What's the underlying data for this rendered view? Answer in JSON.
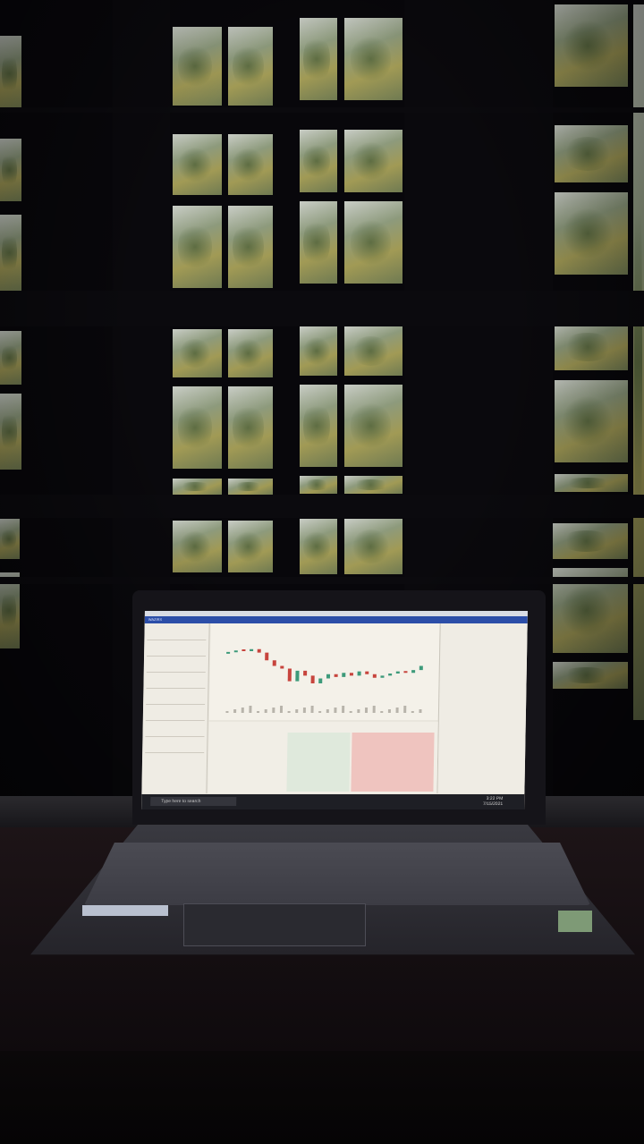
{
  "photo": {
    "subject": "laptop-in-front-of-window",
    "colors": {
      "wall": "#08070b",
      "glass_light": "#c9cdc6",
      "foliage": "#8d9a7c",
      "desk": "#1d1417",
      "laptop": "#151419",
      "screen": "#e9e6dd",
      "chart_up": "#3d9a7a",
      "chart_down": "#c7443d",
      "app_accent": "#2c4ea8"
    }
  },
  "screen": {
    "taskbar_search": "Type here to search",
    "app_name": "WAZIRX",
    "time": "3:22 PM",
    "date": "7/15/2021"
  },
  "chart": {
    "prices": [
      0.72,
      0.74,
      0.73,
      0.76,
      0.71,
      0.6,
      0.52,
      0.48,
      0.3,
      0.45,
      0.38,
      0.27,
      0.34,
      0.4,
      0.36,
      0.42,
      0.38,
      0.44,
      0.4,
      0.35,
      0.38,
      0.41,
      0.44,
      0.42,
      0.46,
      0.52
    ]
  }
}
